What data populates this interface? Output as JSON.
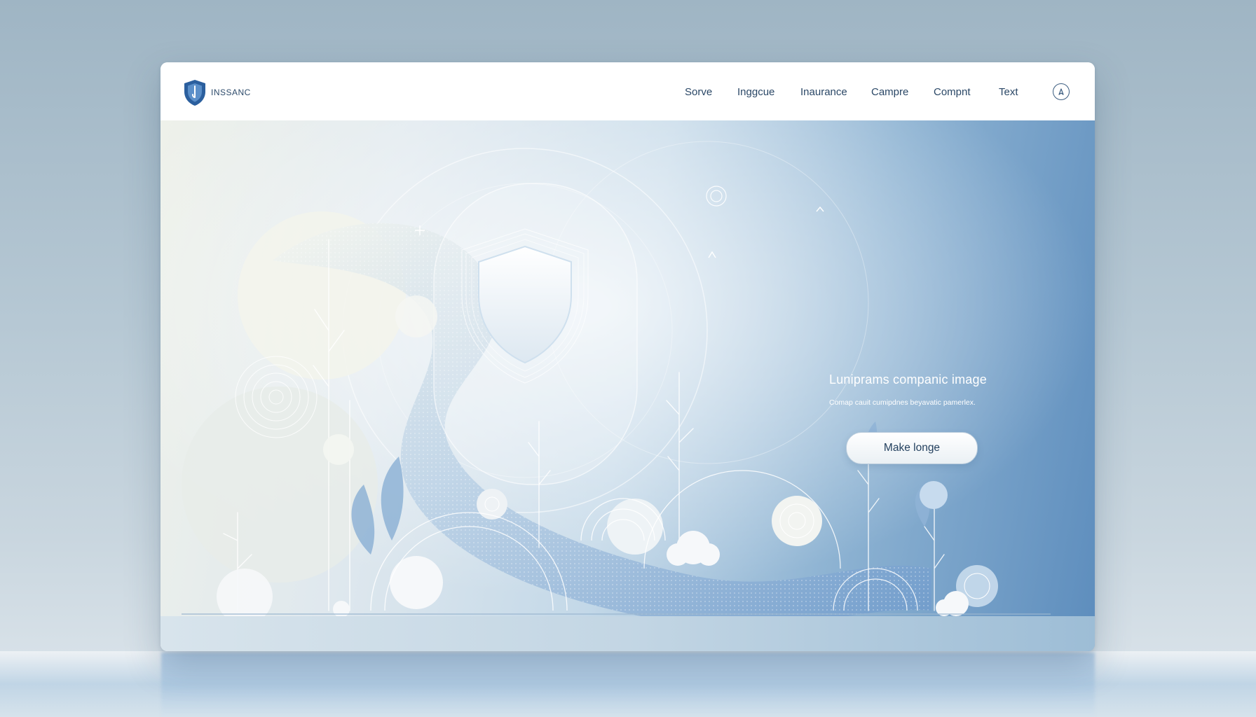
{
  "brand": {
    "name": "INSSANC"
  },
  "nav": {
    "items": [
      {
        "label": "Sorve"
      },
      {
        "label": "Inggcue"
      },
      {
        "label": "Inaurance"
      },
      {
        "label": "Campre"
      },
      {
        "label": "Compnt"
      },
      {
        "label": "Text"
      }
    ]
  },
  "hero": {
    "title": "Luniprams companic image",
    "subtitle": "Comap cauit cumipdnes beyavatic pamerlex.",
    "cta_label": "Make longe"
  },
  "icons": {
    "brand": "shield-logo-icon",
    "nav_avatar": "user-avatar-icon",
    "hero_centerpiece": "shield-icon"
  },
  "colors": {
    "brand_blue": "#2b5f9e",
    "nav_text": "#2a4766",
    "hero_gradient_start": "#eef1ea",
    "hero_gradient_end": "#5d8dbd",
    "cta_background": "#ffffff"
  }
}
